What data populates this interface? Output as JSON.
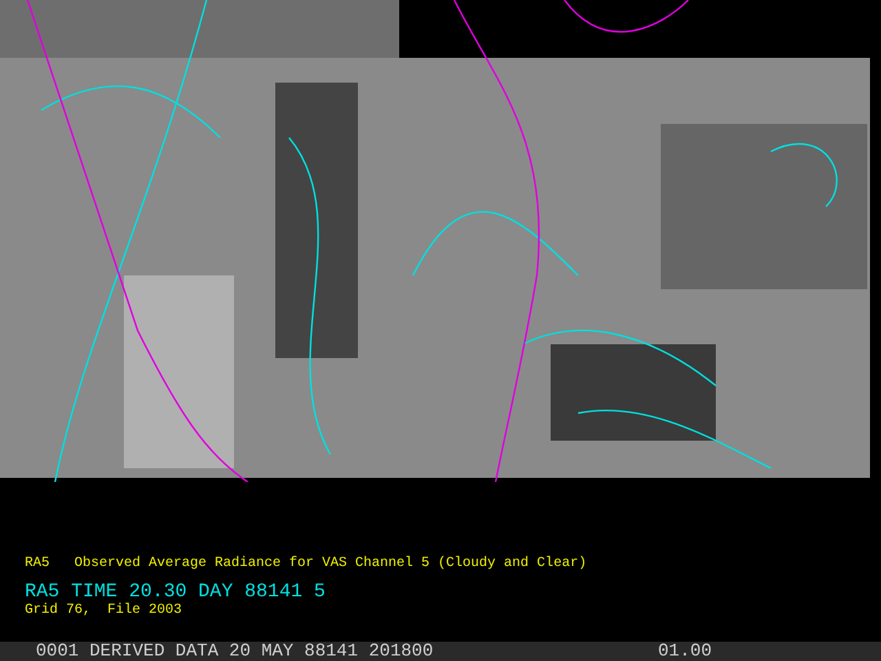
{
  "caption": {
    "title": "RA5   Observed Average Radiance for VAS Channel 5 (Cloudy and Clear)",
    "time_line": "RA5 TIME 20.30 DAY 88141 5",
    "grid_line": "Grid 76,  File 2003"
  },
  "status_bar": {
    "frame": "0001 DERIVED DATA 20 MAY 88141 201800",
    "value": "01.00"
  }
}
